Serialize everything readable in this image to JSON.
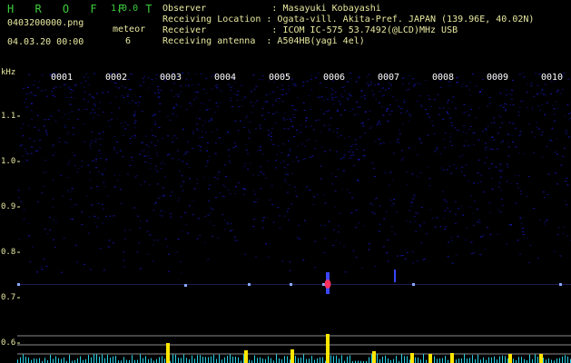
{
  "app": {
    "logo": "H R O F F T",
    "version": "1.0.0"
  },
  "file": {
    "name": "0403200000.png",
    "datetime": "04.03.20 00:00"
  },
  "meteor": {
    "label": "meteor",
    "count": "6"
  },
  "info": {
    "observer": "Observer            : Masayuki Kobayashi",
    "location": "Receiving Location : Ogata-vill. Akita-Pref. JAPAN (139.96E, 40.02N)",
    "receiver": "Receiver            : ICOM IC-575 53.7492(@LCD)MHz USB",
    "antenna": "Receiving antenna  : A504HB(yagi 4el)"
  },
  "axis": {
    "unit": "kHz",
    "y_ticks": [
      "1.1",
      "1.0",
      "0.9",
      "0.8",
      "0.7",
      "0.6"
    ],
    "x_ticks": [
      "0001",
      "0002",
      "0003",
      "0004",
      "0005",
      "0006",
      "0007",
      "0008",
      "0009",
      "0010"
    ]
  },
  "colors": {
    "background": "#000000",
    "noise_blue": "#1e1ee6",
    "echo_red": "#ff3060",
    "bar_yellow": "#ffe600",
    "baseline_cyan": "#28d2e6",
    "logo_green": "#3ccc3c",
    "label_cream": "#e8e8a0"
  }
}
